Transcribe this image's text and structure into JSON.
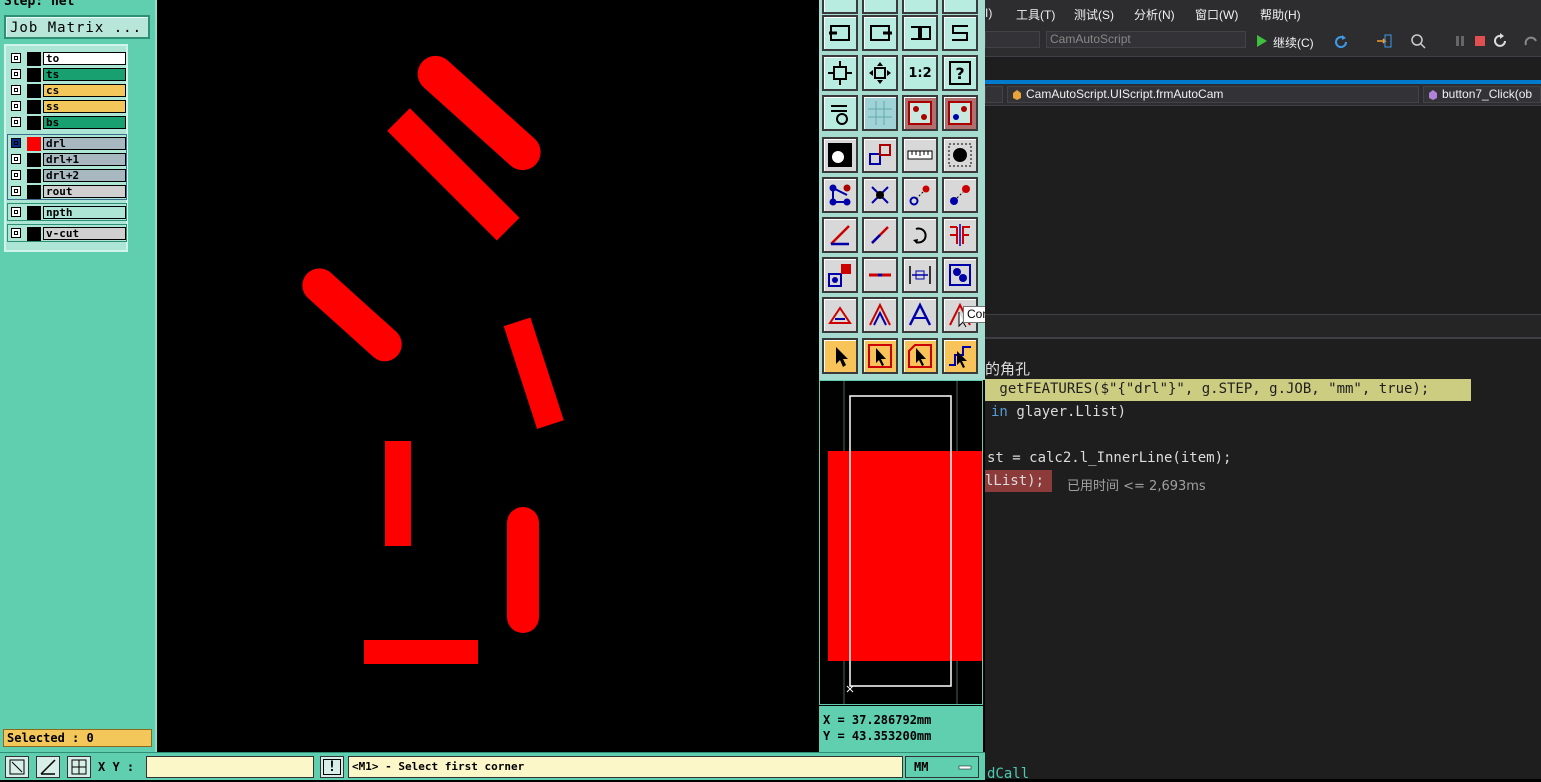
{
  "left_panel": {
    "step_label": "Step: net",
    "job_matrix_button": "Job Matrix ...",
    "layers": [
      {
        "name": "to",
        "color": "#ffffff",
        "swatch": "#000000"
      },
      {
        "name": "ts",
        "color": "#18a070",
        "swatch": "#000000"
      },
      {
        "name": "cs",
        "color": "#f3c75a",
        "swatch": "#000000"
      },
      {
        "name": "ss",
        "color": "#f3c75a",
        "swatch": "#000000"
      },
      {
        "name": "bs",
        "color": "#18a070",
        "swatch": "#000000"
      },
      {
        "name": "drl",
        "color": "#a8b8c0",
        "swatch": "#ff0000"
      },
      {
        "name": "drl+1",
        "color": "#a8b8c0",
        "swatch": "#000000"
      },
      {
        "name": "drl+2",
        "color": "#a8b8c0",
        "swatch": "#000000"
      },
      {
        "name": "rout",
        "color": "#d0d0d0",
        "swatch": "#000000"
      },
      {
        "name": "npth",
        "color": "#aee6d6",
        "swatch": "#000000"
      },
      {
        "name": "v-cut",
        "color": "#d0d0d0",
        "swatch": "#000000"
      }
    ],
    "selected_text": "Selected : 0"
  },
  "toolbar": {
    "tooltip": "Contour editor",
    "scale_label": "1:2",
    "help_label": "?"
  },
  "coords": {
    "x": "X = 37.286792mm",
    "y": "Y = 43.353200mm"
  },
  "bottom_bar": {
    "xy_label": "X Y :",
    "xy_value": "",
    "alert_label": "!",
    "prompt": "<M1> - Select first corner",
    "units": "MM"
  },
  "vs": {
    "menu": [
      "I)",
      "工具(T)",
      "测试(S)",
      "分析(N)",
      "窗口(W)",
      "帮助(H)"
    ],
    "config_combo": "CamAutoScript",
    "continue_label": "继续(C)",
    "class_combo": "CamAutoScript.UIScript.frmAutoCam",
    "method_combo": "button7_Click(ob",
    "code": {
      "line1": "的角孔",
      "line2": " getFEATURES($\"{\"drl\"}\", g.STEP, g.JOB, \"mm\", true);",
      "line3_kw": "in",
      "line3": " glayer.Llist)",
      "line4": "st = calc2.l_InnerLine(item);",
      "line5": "lList);",
      "elapsed": "已用时间 <= 2,693ms",
      "line6": "dCall"
    }
  },
  "colors": {
    "feature_red": "#ff0000",
    "panel_teal": "#5fcfb0",
    "vs_background": "#1e1e1e",
    "vs_accent": "#007acc"
  }
}
